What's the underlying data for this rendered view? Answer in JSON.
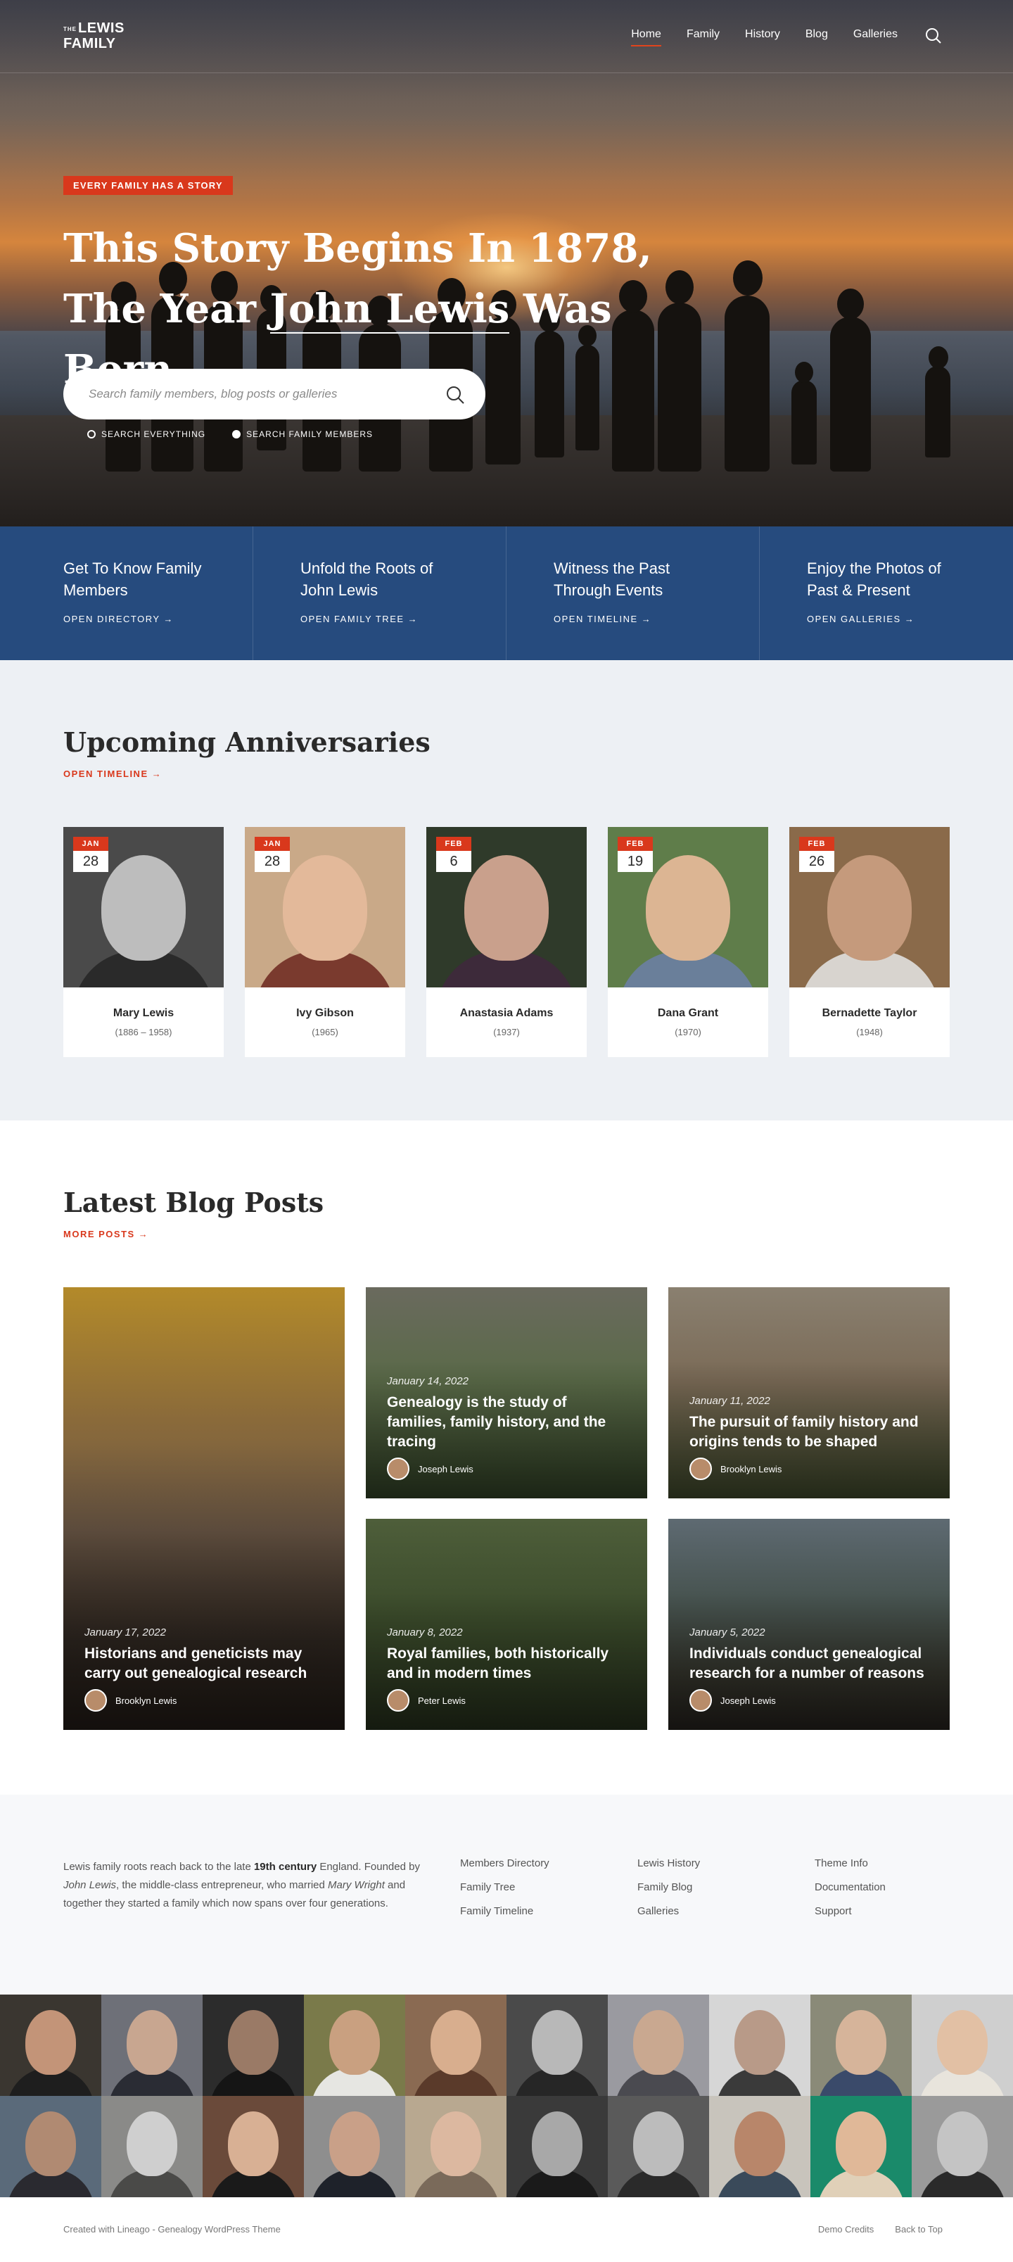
{
  "brand": {
    "the": "THE",
    "line1": "LEWIS",
    "line2": "FAMILY"
  },
  "nav": {
    "items": [
      "Home",
      "Family",
      "History",
      "Blog",
      "Galleries"
    ],
    "active": "Home"
  },
  "hero": {
    "badge": "EVERY FAMILY HAS A STORY",
    "title_line1": "This Story Begins In 1878,",
    "title_pre": "The Year ",
    "title_highlight": "John Lewis",
    "title_post": " Was Born",
    "search_placeholder": "Search family members, blog posts or galleries",
    "search_options": [
      "SEARCH EVERYTHING",
      "SEARCH FAMILY MEMBERS"
    ],
    "search_selected": "SEARCH FAMILY MEMBERS"
  },
  "features": [
    {
      "title": "Get To Know Family Members",
      "link": "OPEN DIRECTORY →"
    },
    {
      "title": "Unfold the Roots of John Lewis",
      "link": "OPEN FAMILY TREE →"
    },
    {
      "title": "Witness the Past Through Events",
      "link": "OPEN TIMELINE →"
    },
    {
      "title": "Enjoy the Photos of Past & Present",
      "link": "OPEN GALLERIES →"
    }
  ],
  "anniversaries": {
    "title": "Upcoming Anniversaries",
    "link": "OPEN TIMELINE →",
    "people": [
      {
        "month": "JAN",
        "day": "28",
        "name": "Mary Lewis",
        "years": "(1886 – 1958)"
      },
      {
        "month": "JAN",
        "day": "28",
        "name": "Ivy Gibson",
        "years": "(1965)"
      },
      {
        "month": "FEB",
        "day": "6",
        "name": "Anastasia Adams",
        "years": "(1937)"
      },
      {
        "month": "FEB",
        "day": "19",
        "name": "Dana Grant",
        "years": "(1970)"
      },
      {
        "month": "FEB",
        "day": "26",
        "name": "Bernadette Taylor",
        "years": "(1948)"
      }
    ]
  },
  "blog": {
    "title": "Latest Blog Posts",
    "link": "MORE POSTS →",
    "posts": [
      {
        "date": "January 17, 2022",
        "title": "Historians and geneticists may carry out genealogical research",
        "author": "Brooklyn Lewis"
      },
      {
        "date": "January 14, 2022",
        "title": "Genealogy is the study of families, family history, and the tracing",
        "author": "Joseph Lewis"
      },
      {
        "date": "January 11, 2022",
        "title": "The pursuit of family history and origins tends to be shaped",
        "author": "Brooklyn Lewis"
      },
      {
        "date": "January 8, 2022",
        "title": "Royal families, both historically and in modern times",
        "author": "Peter Lewis"
      },
      {
        "date": "January 5, 2022",
        "title": "Individuals conduct genealogical research for a number of reasons",
        "author": "Joseph Lewis"
      }
    ]
  },
  "footer": {
    "about_1": "Lewis family roots reach back to the late ",
    "about_bold": "19th century",
    "about_2": " England. Founded by ",
    "about_founder": "John Lewis",
    "about_3": ", the middle-class entrepreneur, who married ",
    "about_wife": "Mary Wright",
    "about_4": " and together they started a family which now spans over four generations.",
    "col1": [
      "Members Directory",
      "Family Tree",
      "Family Timeline"
    ],
    "col2": [
      "Lewis History",
      "Family Blog",
      "Galleries"
    ],
    "col3": [
      "Theme Info",
      "Documentation",
      "Support"
    ],
    "credit": "Created with Lineago - Genealogy WordPress Theme",
    "bottom_links": [
      "Demo Credits",
      "Back to Top"
    ]
  },
  "colors": {
    "accent": "#d9381c",
    "navy": "#264b7e",
    "light_bg": "#edf0f4"
  }
}
